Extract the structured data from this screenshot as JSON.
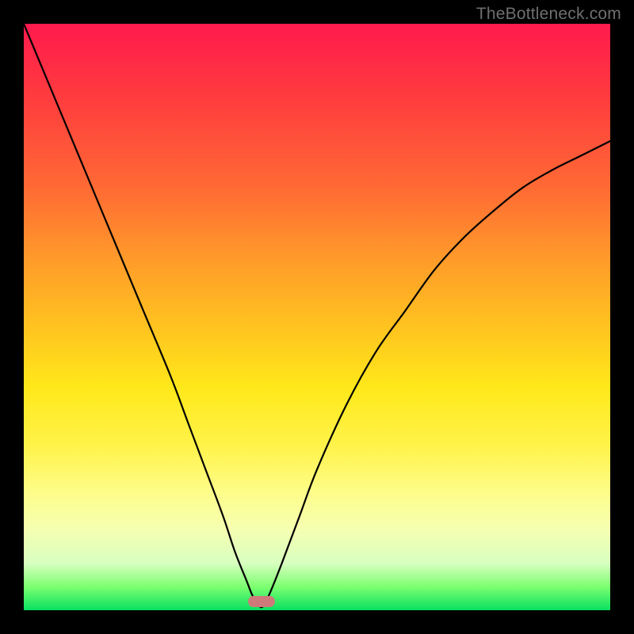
{
  "watermark": "TheBottleneck.com",
  "chart_data": {
    "type": "line",
    "title": "",
    "xlabel": "",
    "ylabel": "",
    "xlim": [
      0,
      100
    ],
    "ylim": [
      0,
      100
    ],
    "grid": false,
    "legend": false,
    "gradient_meaning": "background vertical gradient maps to bottleneck severity: top=red (high bottleneck), bottom=green (low bottleneck)",
    "marker": {
      "x": 40.5,
      "y": 1.5,
      "shape": "rounded-pill",
      "color": "#cf7a7a"
    },
    "series": [
      {
        "name": "bottleneck-curve",
        "color": "#000000",
        "x": [
          0,
          5,
          10,
          15,
          20,
          25,
          28,
          31,
          34,
          36,
          38,
          39,
          40,
          40.5,
          41,
          42,
          44,
          47,
          50,
          55,
          60,
          65,
          70,
          75,
          80,
          85,
          90,
          95,
          100
        ],
        "y": [
          100,
          88,
          76,
          64,
          52,
          40,
          32,
          24,
          16,
          10,
          5,
          2.5,
          1,
          0.5,
          1,
          3,
          8,
          16,
          24,
          35,
          44,
          51,
          58,
          63.5,
          68,
          72,
          75,
          77.5,
          80
        ]
      }
    ]
  }
}
